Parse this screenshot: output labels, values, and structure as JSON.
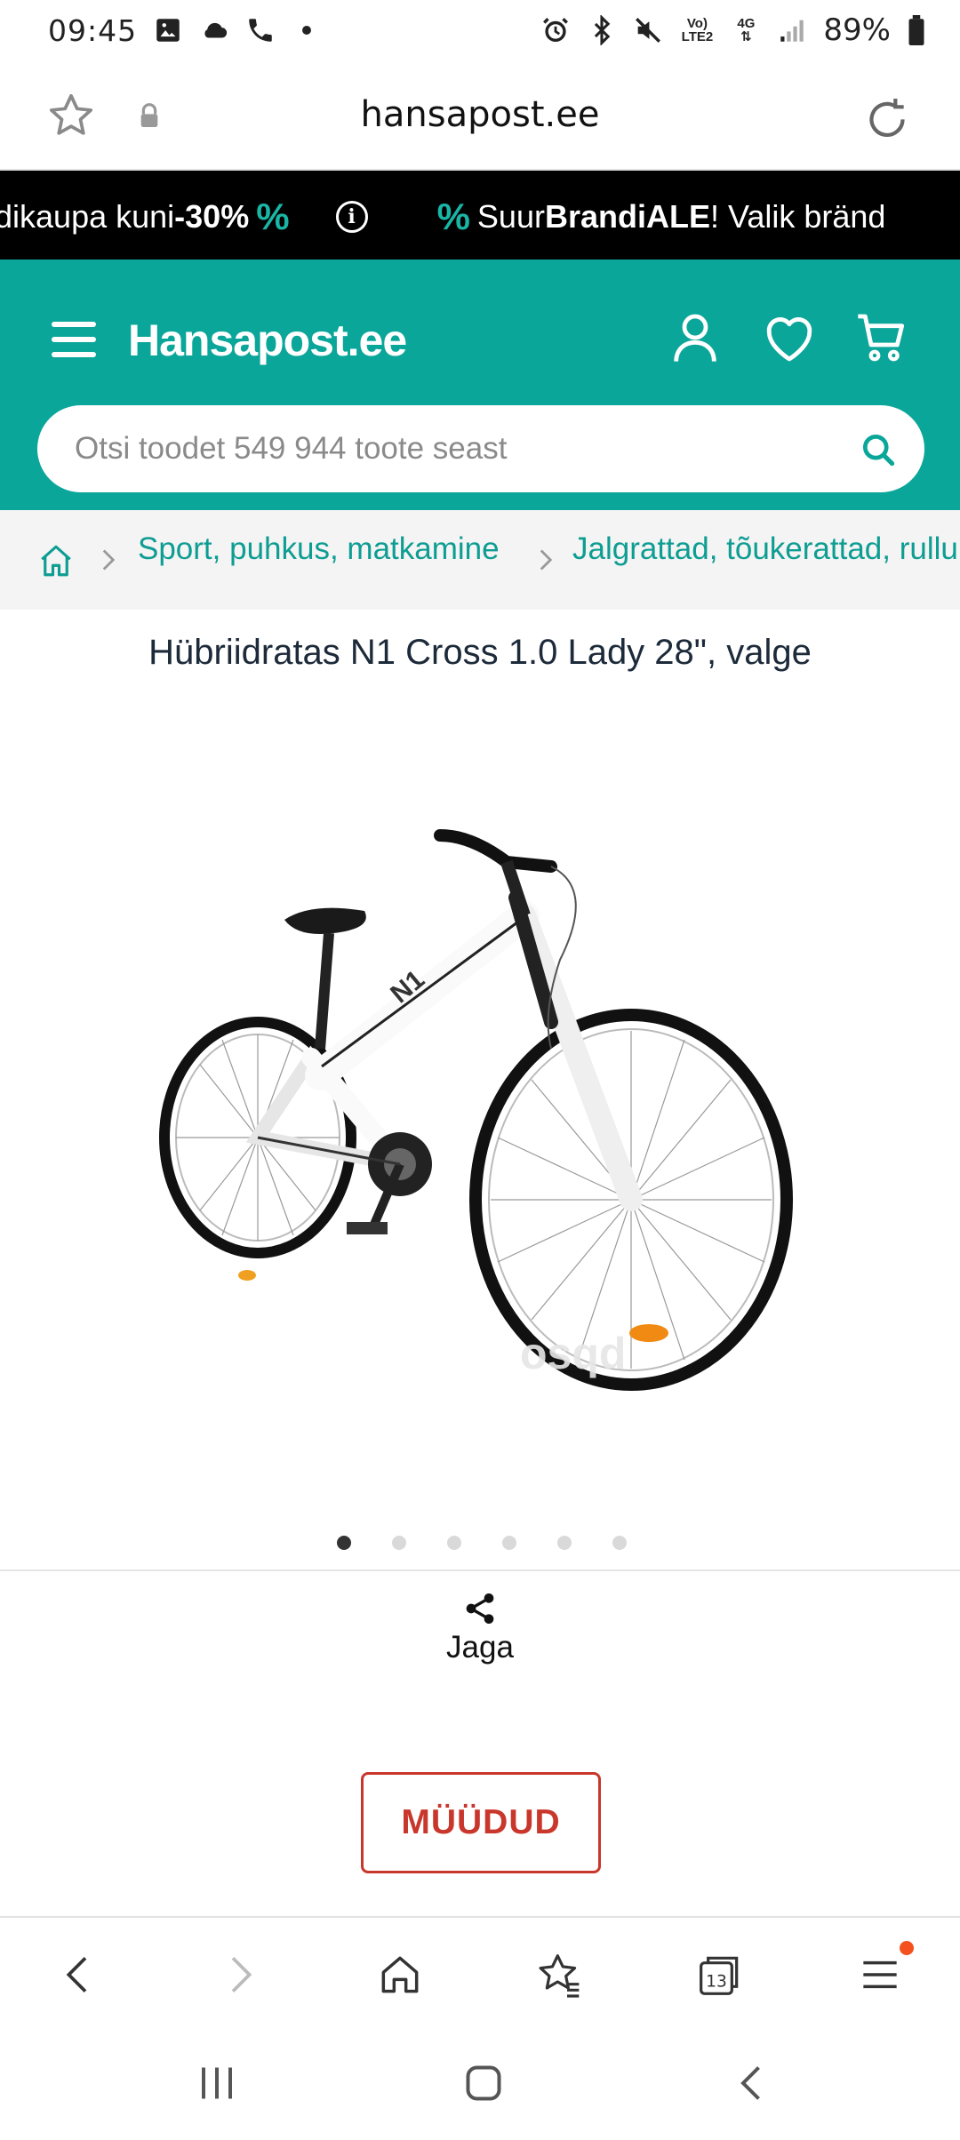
{
  "status_bar": {
    "time": "09:45",
    "battery": "89%",
    "network_top": "Vo)",
    "network_bottom": "LTE2",
    "signal_label": "4G",
    "icons": [
      "gallery-icon",
      "cloud-icon",
      "phone-icon",
      "dot-icon",
      "alarm-icon",
      "bluetooth-icon",
      "mute-icon",
      "volte-icon",
      "4g-icon",
      "signal-icon",
      "battery-icon"
    ]
  },
  "browser": {
    "url": "hansapost.ee"
  },
  "promo": {
    "part1": "dikaupa kuni ",
    "part1_bold": "-30%",
    "pct_symbol": "%",
    "info": "i",
    "part2_pre": "Suur ",
    "part2_bold": "BrandiALE",
    "part2_post": "! Valik bränd"
  },
  "header": {
    "logo": "Hansapost.ee",
    "search_placeholder": "Otsi toodet 549 944 toote seast"
  },
  "breadcrumb": {
    "items": [
      "Sport, puhkus, matkamine",
      "Jalgrattad, tõukerattad, rulluisud"
    ]
  },
  "product": {
    "title": "Hübriidratas N1 Cross 1.0 Lady 28\", valge",
    "image_count": 6,
    "active_image": 0,
    "share_label": "Jaga",
    "status": "MÜÜDUD",
    "tabs_count": "13"
  },
  "colors": {
    "brand": "#0aa69a",
    "link": "#0e9d92",
    "sold": "#c9372c",
    "promo_bg": "#000000"
  }
}
